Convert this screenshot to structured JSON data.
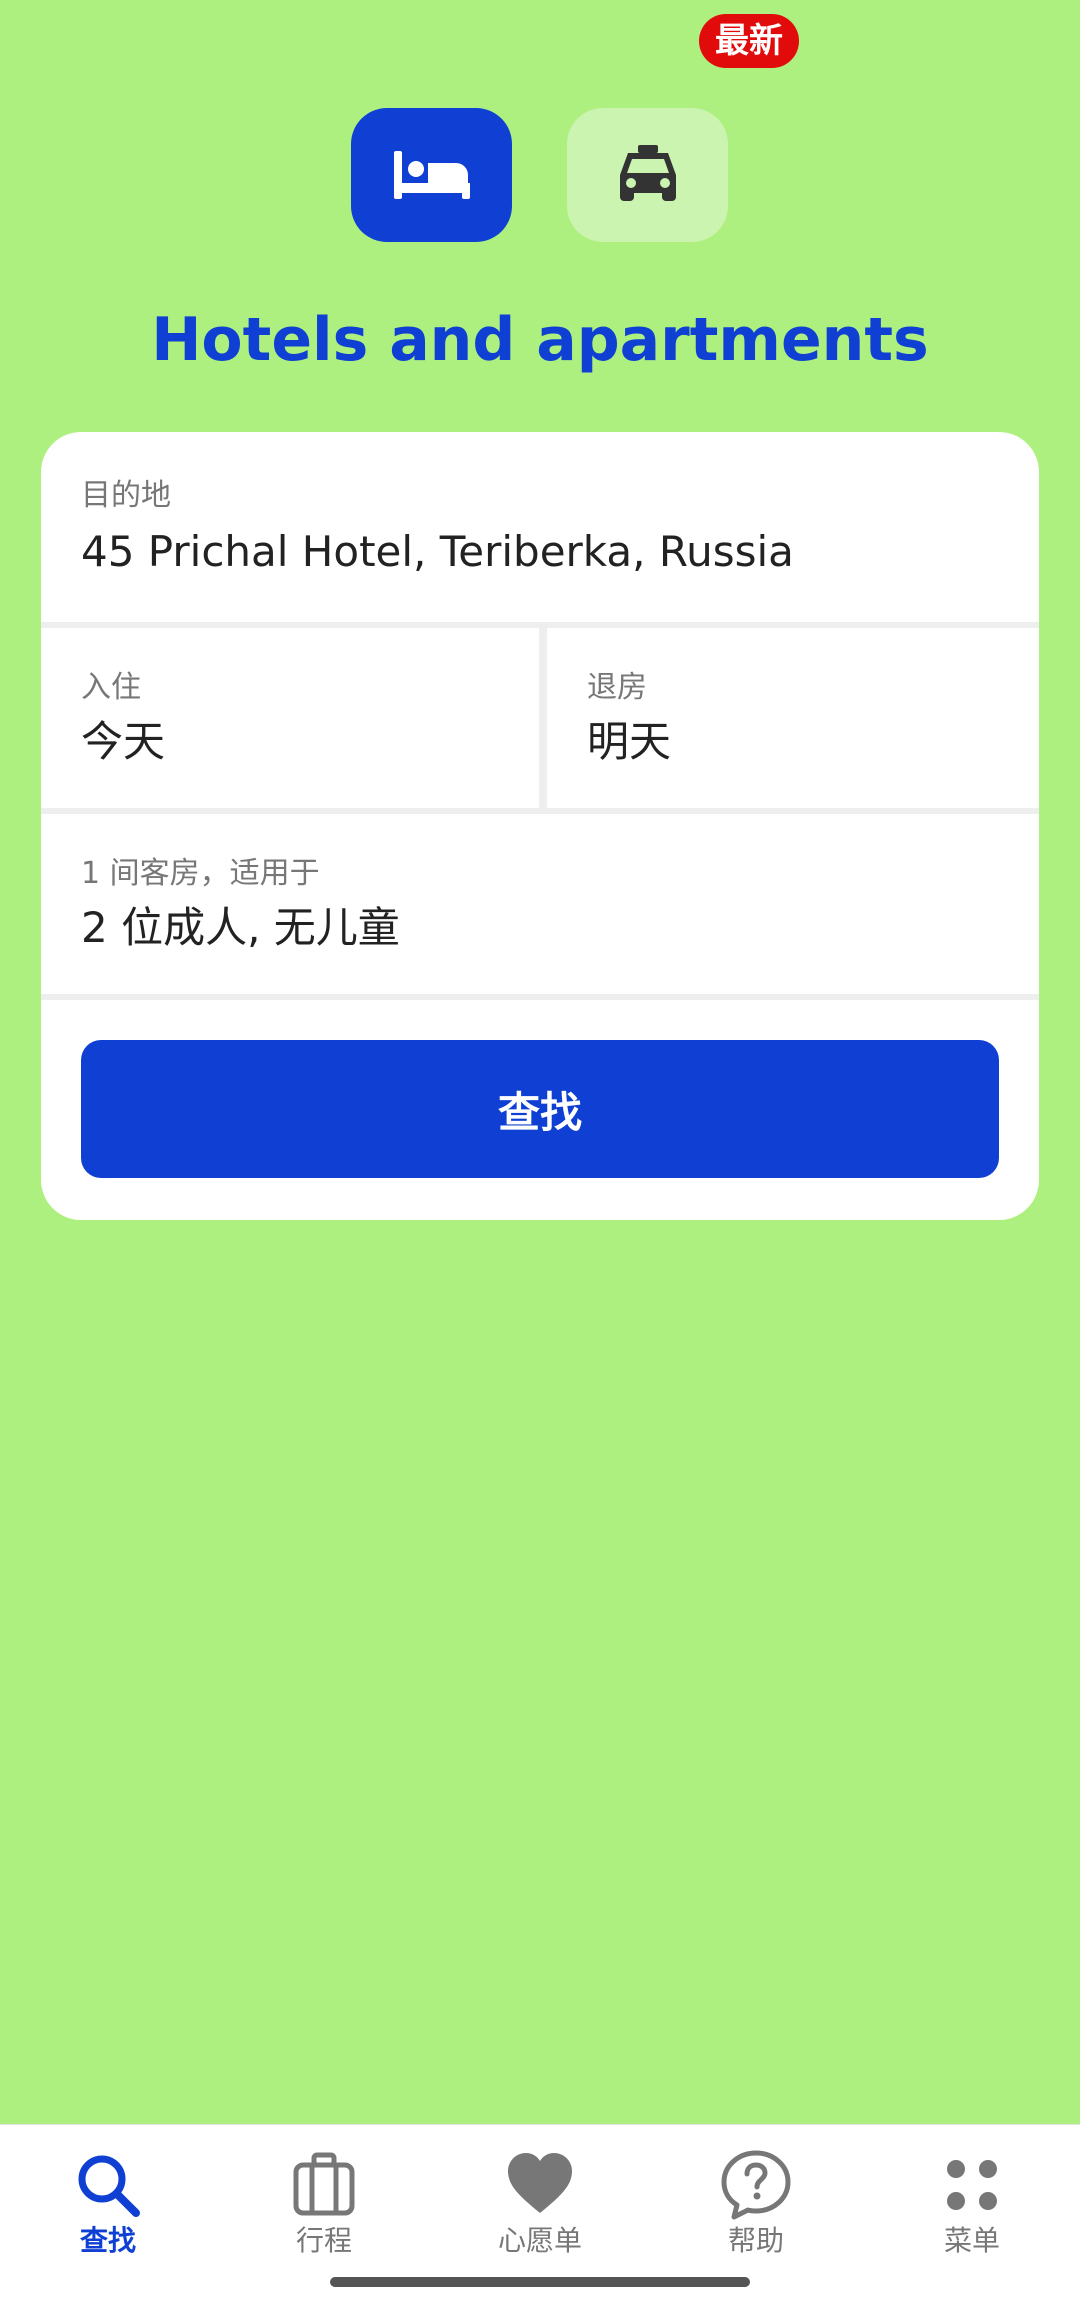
{
  "modes": {
    "hotel_icon": "bed-icon",
    "taxi_icon": "taxi-icon",
    "taxi_badge": "最新"
  },
  "title": "Hotels and apartments",
  "search_form": {
    "destination_label": "目的地",
    "destination_value": "45 Prichal Hotel, Teriberka, Russia",
    "checkin_label": "入住",
    "checkin_value": "今天",
    "checkout_label": "退房",
    "checkout_value": "明天",
    "guests_label": "1 间客房，适用于",
    "guests_value": "2 位成人, 无儿童",
    "search_button": "查找"
  },
  "bottom_nav": {
    "items": [
      {
        "label": "查找",
        "icon": "search-icon",
        "active": true
      },
      {
        "label": "行程",
        "icon": "briefcase-icon",
        "active": false
      },
      {
        "label": "心愿单",
        "icon": "heart-icon",
        "active": false
      },
      {
        "label": "帮助",
        "icon": "help-icon",
        "active": false
      },
      {
        "label": "菜单",
        "icon": "menu-dots-icon",
        "active": false
      }
    ]
  },
  "colors": {
    "background": "#adf07f",
    "brand_blue": "#0f40d3",
    "badge_red": "#e10b0b"
  }
}
